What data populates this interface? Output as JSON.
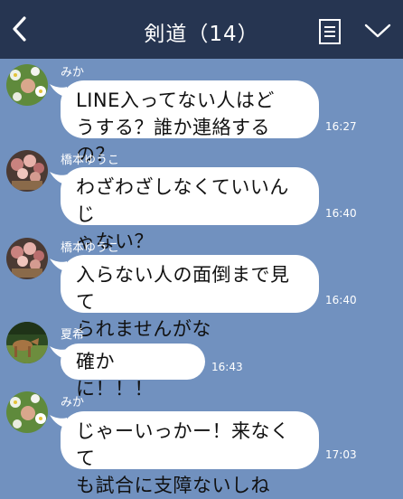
{
  "header": {
    "title": "剣道（14）"
  },
  "messages": [
    {
      "sender": "みか",
      "text": "LINE入ってない人はど\nうする？誰か連絡するの？",
      "time": "16:27"
    },
    {
      "sender": "橋本ゆうこ",
      "text": "わざわざしなくていいんじ\nゃない？",
      "time": "16:40"
    },
    {
      "sender": "橋本ゆうこ",
      "text": "入らない人の面倒まで見て\nられませんがな",
      "time": "16:40"
    },
    {
      "sender": "夏希",
      "text": "確かに！！！",
      "time": "16:43"
    },
    {
      "sender": "みか",
      "text": "じゃーいっかー！来なくて\nも試合に支障ないしね",
      "time": "17:03"
    }
  ],
  "icons": {
    "back": "chevron-left-icon",
    "menu": "note-list-icon",
    "expand": "chevron-down-icon"
  },
  "colors": {
    "header_bg": "#263551",
    "chat_bg": "#7191bf",
    "bubble": "#ffffff"
  }
}
